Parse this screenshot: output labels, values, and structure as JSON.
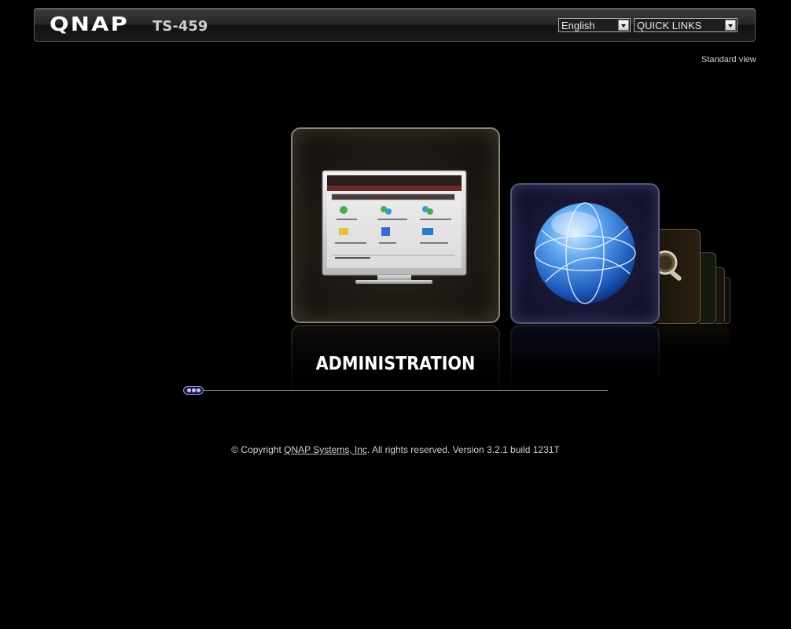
{
  "header": {
    "logo": "QNAP",
    "model": "TS-459",
    "language": {
      "selected": "English"
    },
    "quick_links": {
      "selected": "QUICK LINKS"
    }
  },
  "standard_view": "Standard view",
  "carousel": {
    "current_caption": "ADMINISTRATION",
    "monitor": {
      "window_title": "Quick Start",
      "section_title": "Turbo Station Wizard",
      "tasks": [
        "Create an user",
        "Create multiple Users",
        "Create an User Group",
        "Create a Shared Folder",
        "FTP Server",
        "Remote Replication"
      ],
      "bottom_label": "QPKG Software packages"
    }
  },
  "footer": {
    "prefix": "© Copyright ",
    "company_link": "QNAP Systems, Inc",
    "suffix": ". All rights reserved. Version 3.2.1 build 1231T"
  },
  "colors": {
    "background": "#000000",
    "admin_card_border": "#8a8378",
    "network_card_border": "#57577a",
    "globe_blue": "#3a86e0"
  }
}
